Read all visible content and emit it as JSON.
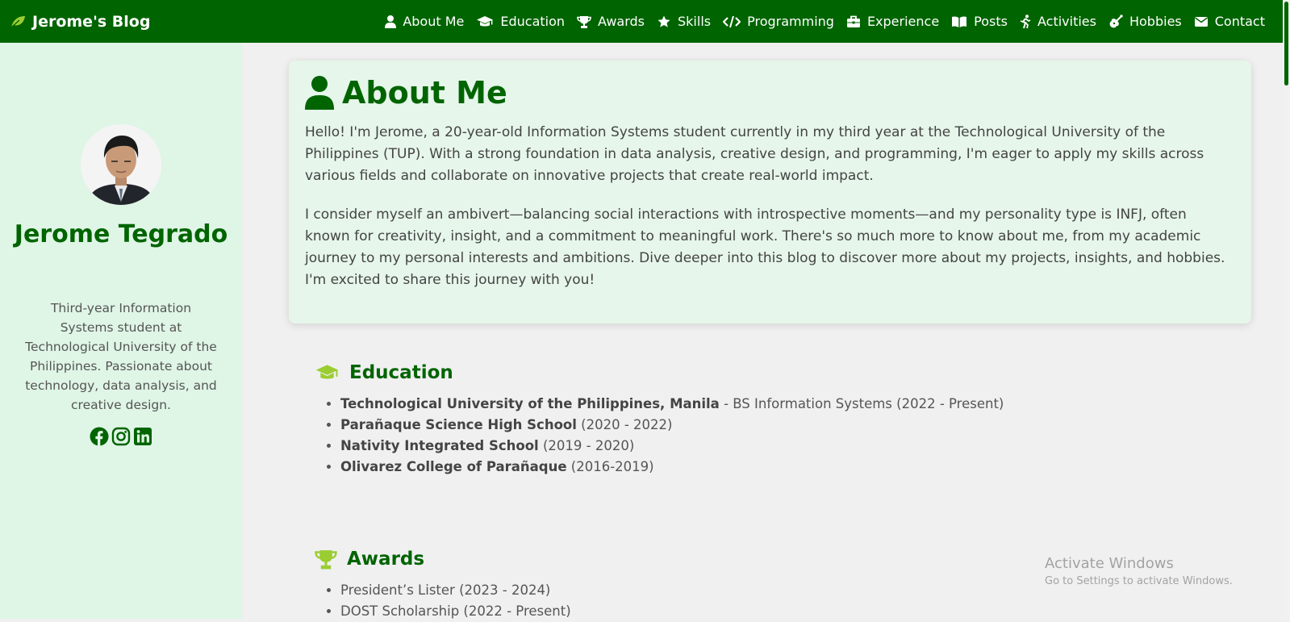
{
  "navbar": {
    "brand": "Jerome's Blog",
    "items": [
      {
        "label": "About Me",
        "icon": "user-icon"
      },
      {
        "label": "Education",
        "icon": "graduation-cap-icon"
      },
      {
        "label": "Awards",
        "icon": "trophy-icon"
      },
      {
        "label": "Skills",
        "icon": "star-icon"
      },
      {
        "label": "Programming",
        "icon": "code-icon"
      },
      {
        "label": "Experience",
        "icon": "briefcase-icon"
      },
      {
        "label": "Posts",
        "icon": "book-open-icon"
      },
      {
        "label": "Activities",
        "icon": "running-icon"
      },
      {
        "label": "Hobbies",
        "icon": "guitar-icon"
      },
      {
        "label": "Contact",
        "icon": "envelope-icon"
      }
    ]
  },
  "sidebar": {
    "name": "Jerome Tegrado",
    "bio": "Third-year Information Systems student at Technological University of the Philippines. Passionate about technology, data analysis, and creative design.",
    "socials": [
      "facebook-icon",
      "instagram-icon",
      "linkedin-icon"
    ]
  },
  "about": {
    "title": "About Me",
    "p1": "Hello! I'm Jerome, a 20-year-old Information Systems student currently in my third year at the Technological University of the Philippines (TUP). With a strong foundation in data analysis, creative design, and programming, I'm eager to apply my skills across various fields and collaborate on innovative projects that create real-world impact.",
    "p2": "I consider myself an ambivert—balancing social interactions with introspective moments—and my personality type is INFJ, often known for creativity, insight, and a commitment to meaningful work. There's so much more to know about me, from my academic journey to my personal interests and ambitions. Dive deeper into this blog to discover more about my projects, insights, and hobbies. I'm excited to share this journey with you!"
  },
  "education": {
    "title": "Education",
    "items": [
      {
        "school": "Technological University of the Philippines, Manila",
        "detail": " - BS Information Systems (2022 - Present)"
      },
      {
        "school": "Parañaque Science High School",
        "detail": " (2020 - 2022)"
      },
      {
        "school": "Nativity Integrated School",
        "detail": " (2019 - 2020)"
      },
      {
        "school": "Olivarez College of Parañaque",
        "detail": " (2016-2019)"
      }
    ]
  },
  "awards": {
    "title": "Awards",
    "items": [
      "President’s Lister (2023 - 2024)",
      "DOST Scholarship (2022 - Present)"
    ]
  },
  "watermark": {
    "line1": "Activate Windows",
    "line2": "Go to Settings to activate Windows."
  },
  "colors": {
    "primary": "#006400",
    "accent": "#9acd32",
    "sidebar_bg": "#dff5e6",
    "card_bg": "#e6f6ea",
    "page_bg": "#f0f0f0"
  }
}
